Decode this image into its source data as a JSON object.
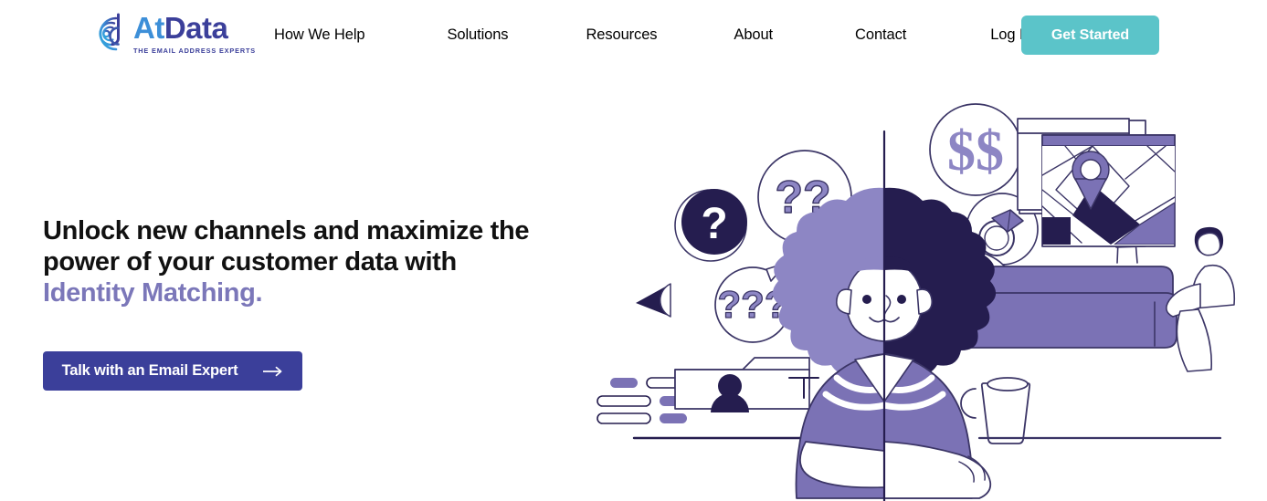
{
  "header": {
    "logo": {
      "mark_icon": "at-symbol-logo-icon",
      "word_part1": "At",
      "word_part2": "Data",
      "tagline": "THE EMAIL ADDRESS EXPERTS",
      "color_part1": "#3d8fd8",
      "color_part2": "#3b3f9a"
    },
    "nav": [
      {
        "label": "How We Help"
      },
      {
        "label": "Solutions"
      },
      {
        "label": "Resources"
      },
      {
        "label": "About"
      },
      {
        "label": "Contact"
      },
      {
        "label": "Log In"
      }
    ],
    "cta": {
      "label": "Get Started",
      "background": "#5bc4c9",
      "text_color": "#ffffff"
    }
  },
  "hero": {
    "headline_line1": "Unlock new channels and maximize the",
    "headline_line2": "power of your customer data with",
    "headline_accent": "Identity Matching.",
    "headline_color": "#111111",
    "accent_color": "#7b77b9",
    "cta": {
      "label": "Talk with an Email Expert",
      "arrow_icon": "arrow-right-icon",
      "background": "#3b3f9a",
      "text_color": "#ffffff"
    }
  },
  "illustration": {
    "name": "identity-matching-hero-illustration",
    "palette": {
      "dark_navy": "#251d4f",
      "purple": "#7b72b5",
      "light_purple": "#8d86c4",
      "white": "#ffffff"
    },
    "elements": [
      {
        "name": "question-circle-dark",
        "label": "?"
      },
      {
        "name": "speech-bubble-double-question",
        "label": "??"
      },
      {
        "name": "speech-bubble-triple-question",
        "label": "???"
      },
      {
        "name": "triangle-arrow-marker",
        "label": ""
      },
      {
        "name": "dollar-thought-bubble",
        "label": "$$"
      },
      {
        "name": "diamond-ring-thought-bubble",
        "label": ""
      },
      {
        "name": "cube-3d-icon",
        "label": ""
      },
      {
        "name": "person-profile-folder-card",
        "label": ""
      },
      {
        "name": "list-pill-bars",
        "label": ""
      },
      {
        "name": "map-window-with-location-pin",
        "label": ""
      },
      {
        "name": "coffee-mug",
        "label": ""
      },
      {
        "name": "couch-with-three-people",
        "label": ""
      },
      {
        "name": "central-figure-split-portrait",
        "label": ""
      },
      {
        "name": "vertical-divider-line",
        "label": ""
      }
    ]
  }
}
